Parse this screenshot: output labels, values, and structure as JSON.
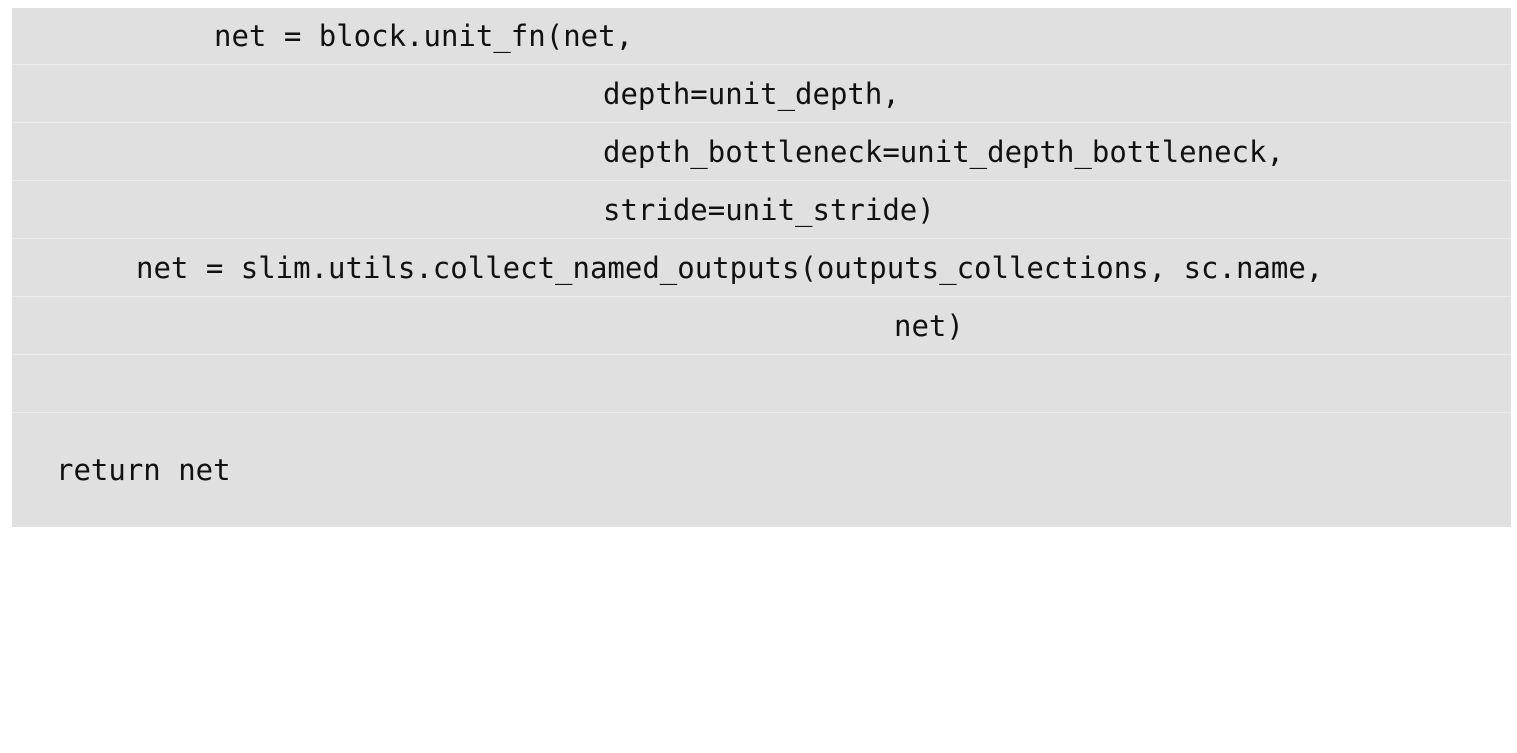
{
  "code": {
    "lines": [
      "net = block.unit_fn(net,",
      "depth=unit_depth,",
      "depth_bottleneck=unit_depth_bottleneck,",
      "stride=unit_stride)",
      "net = slim.utils.collect_named_outputs(outputs_collections, sc.name,",
      "net)",
      "",
      "return net"
    ]
  }
}
